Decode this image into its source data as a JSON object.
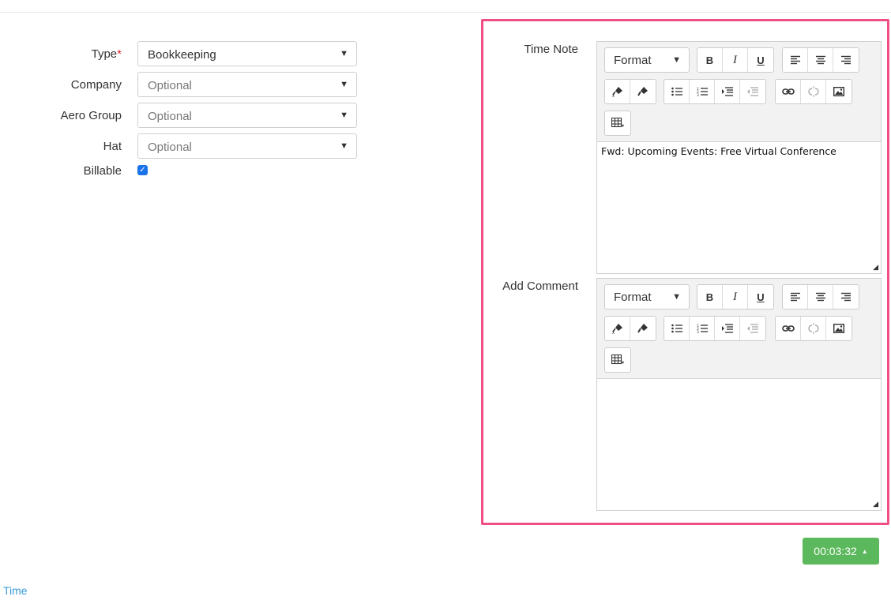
{
  "form": {
    "type": {
      "label": "Type",
      "required_mark": "*",
      "value": "Bookkeeping"
    },
    "company": {
      "label": "Company",
      "placeholder": "Optional"
    },
    "aero_group": {
      "label": "Aero Group",
      "placeholder": "Optional"
    },
    "hat": {
      "label": "Hat",
      "placeholder": "Optional"
    },
    "billable": {
      "label": "Billable",
      "checked": true
    }
  },
  "time_note": {
    "label": "Time Note",
    "format_label": "Format",
    "content": "Fwd: Upcoming Events: Free Virtual Conference"
  },
  "add_comment": {
    "label": "Add Comment",
    "format_label": "Format",
    "content": ""
  },
  "toolbar": {
    "bold": "B",
    "italic": "I",
    "underline": "U"
  },
  "timer": {
    "value": "00:03:32"
  },
  "footer": {
    "time_link": "Time"
  },
  "colors": {
    "highlight_border": "#ef4f86",
    "timer_bg": "#5cb85c",
    "link": "#3a9ad9",
    "checkbox": "#1a73e8"
  }
}
